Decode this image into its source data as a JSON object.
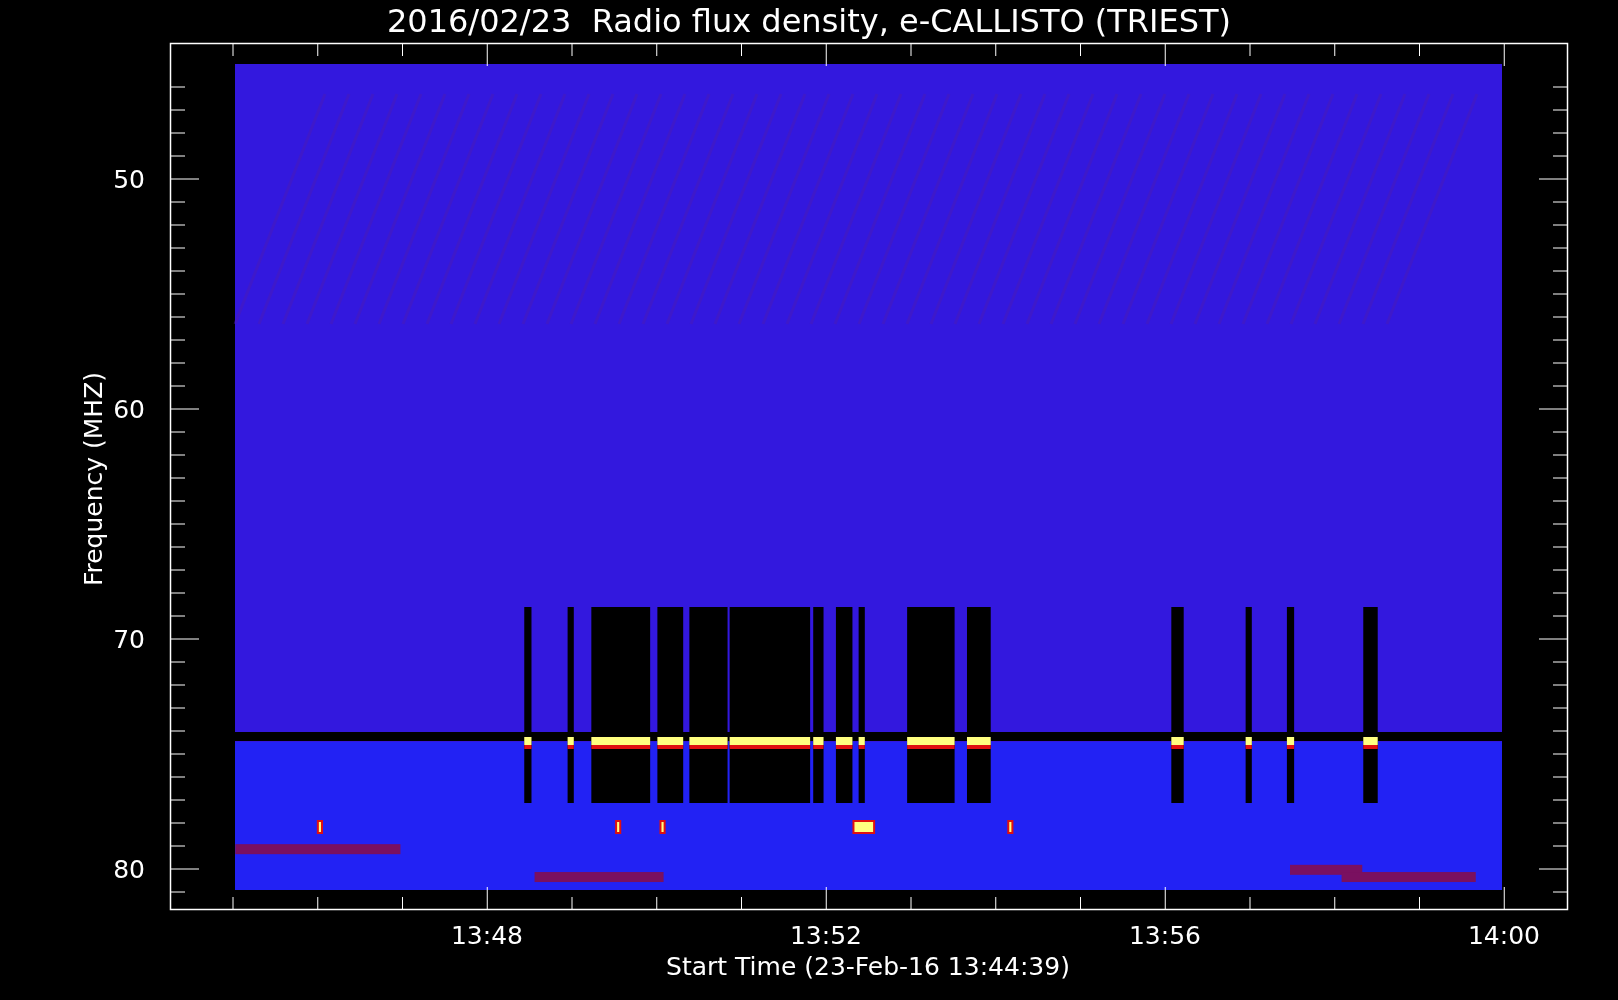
{
  "title": "2016/02/23  Radio flux density, e-CALLISTO (TRIEST)",
  "y_axis": {
    "label": "Frequency (MHZ)",
    "ticks": [
      "50",
      "60",
      "70",
      "80"
    ]
  },
  "x_axis": {
    "label": "Start Time (23-Feb-16 13:44:39)",
    "ticks": [
      "13:48",
      "13:52",
      "13:56",
      "14:00"
    ]
  }
}
